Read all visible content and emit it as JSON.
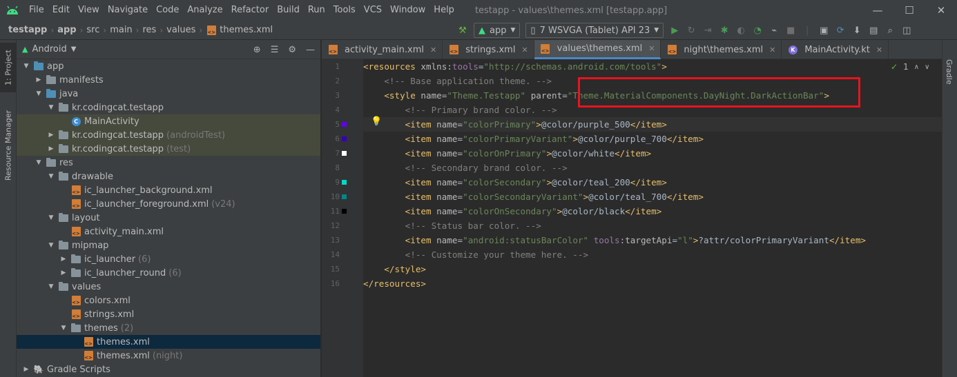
{
  "menu": {
    "items": [
      "File",
      "Edit",
      "View",
      "Navigate",
      "Code",
      "Analyze",
      "Refactor",
      "Build",
      "Run",
      "Tools",
      "VCS",
      "Window",
      "Help"
    ],
    "window_title": "testapp - values\\themes.xml [testapp.app]"
  },
  "breadcrumb": [
    "testapp",
    "app",
    "src",
    "main",
    "res",
    "values",
    "themes.xml"
  ],
  "run": {
    "config": "app",
    "device": "7  WSVGA (Tablet) API 23"
  },
  "left_tabs": {
    "project": "1: Project",
    "resource_manager": "Resource Manager"
  },
  "right_tabs": {
    "gradle": "Gradle"
  },
  "project": {
    "view": "Android",
    "tree": [
      {
        "label": "app",
        "suffix": "",
        "depth": 0,
        "expanded": true,
        "icon": "module-folder-icon"
      },
      {
        "label": "manifests",
        "suffix": "",
        "depth": 1,
        "expanded": false,
        "icon": "folder-icon"
      },
      {
        "label": "java",
        "suffix": "",
        "depth": 1,
        "expanded": true,
        "icon": "source-folder-icon"
      },
      {
        "label": "kr.codingcat.testapp",
        "suffix": "",
        "depth": 2,
        "expanded": true,
        "icon": "package-icon"
      },
      {
        "label": "MainActivity",
        "suffix": "",
        "depth": 3,
        "expanded": null,
        "icon": "kotlin-class-icon"
      },
      {
        "label": "kr.codingcat.testapp",
        "suffix": "(androidTest)",
        "depth": 2,
        "expanded": false,
        "icon": "package-icon"
      },
      {
        "label": "kr.codingcat.testapp",
        "suffix": "(test)",
        "depth": 2,
        "expanded": false,
        "icon": "package-icon"
      },
      {
        "label": "res",
        "suffix": "",
        "depth": 1,
        "expanded": true,
        "icon": "res-folder-icon"
      },
      {
        "label": "drawable",
        "suffix": "",
        "depth": 2,
        "expanded": true,
        "icon": "folder-icon"
      },
      {
        "label": "ic_launcher_background.xml",
        "suffix": "",
        "depth": 3,
        "expanded": null,
        "icon": "xml-file-icon"
      },
      {
        "label": "ic_launcher_foreground.xml",
        "suffix": "(v24)",
        "depth": 3,
        "expanded": null,
        "icon": "xml-file-icon"
      },
      {
        "label": "layout",
        "suffix": "",
        "depth": 2,
        "expanded": true,
        "icon": "folder-icon"
      },
      {
        "label": "activity_main.xml",
        "suffix": "",
        "depth": 3,
        "expanded": null,
        "icon": "xml-file-icon"
      },
      {
        "label": "mipmap",
        "suffix": "",
        "depth": 2,
        "expanded": true,
        "icon": "folder-icon"
      },
      {
        "label": "ic_launcher",
        "suffix": "(6)",
        "depth": 3,
        "expanded": false,
        "icon": "folder-icon"
      },
      {
        "label": "ic_launcher_round",
        "suffix": "(6)",
        "depth": 3,
        "expanded": false,
        "icon": "folder-icon"
      },
      {
        "label": "values",
        "suffix": "",
        "depth": 2,
        "expanded": true,
        "icon": "folder-icon"
      },
      {
        "label": "colors.xml",
        "suffix": "",
        "depth": 3,
        "expanded": null,
        "icon": "xml-file-icon"
      },
      {
        "label": "strings.xml",
        "suffix": "",
        "depth": 3,
        "expanded": null,
        "icon": "xml-file-icon"
      },
      {
        "label": "themes",
        "suffix": "(2)",
        "depth": 3,
        "expanded": true,
        "icon": "folder-icon"
      },
      {
        "label": "themes.xml",
        "suffix": "",
        "depth": 4,
        "expanded": null,
        "icon": "xml-file-icon"
      },
      {
        "label": "themes.xml",
        "suffix": "(night)",
        "depth": 4,
        "expanded": null,
        "icon": "xml-file-icon"
      },
      {
        "label": "Gradle Scripts",
        "suffix": "",
        "depth": 0,
        "expanded": false,
        "icon": "gradle-icon"
      }
    ]
  },
  "tabs": [
    {
      "label": "activity_main.xml",
      "active": false,
      "icon": "xml-file-icon"
    },
    {
      "label": "strings.xml",
      "active": false,
      "icon": "xml-file-icon"
    },
    {
      "label": "values\\themes.xml",
      "active": true,
      "icon": "xml-file-icon"
    },
    {
      "label": "night\\themes.xml",
      "active": false,
      "icon": "xml-file-icon"
    },
    {
      "label": "MainActivity.kt",
      "active": false,
      "icon": "kotlin-file-icon"
    }
  ],
  "inspection": {
    "count": "1"
  },
  "editor": {
    "lines": [
      {
        "n": "1",
        "swatch": null,
        "parts": [
          [
            "tag",
            "<resources "
          ],
          [
            "attr",
            "xmlns:"
          ],
          [
            "ns",
            "tools"
          ],
          [
            "plain",
            "="
          ],
          [
            "val",
            "\"http://schemas.android.com/tools\""
          ],
          [
            "tag",
            ">"
          ]
        ]
      },
      {
        "n": "2",
        "swatch": null,
        "parts": [
          [
            "plain",
            "    "
          ],
          [
            "cmt",
            "<!-- Base application theme. -->"
          ]
        ]
      },
      {
        "n": "3",
        "swatch": null,
        "parts": [
          [
            "plain",
            "    "
          ],
          [
            "tag",
            "<style "
          ],
          [
            "attr",
            "name"
          ],
          [
            "plain",
            "="
          ],
          [
            "val",
            "\"Theme.Testapp\""
          ],
          [
            "plain",
            " "
          ],
          [
            "attr",
            "parent"
          ],
          [
            "plain",
            "="
          ],
          [
            "val",
            "\"Theme.MaterialComponents.DayNight.DarkActionBar\""
          ],
          [
            "tag",
            ">"
          ]
        ]
      },
      {
        "n": "4",
        "swatch": null,
        "parts": [
          [
            "plain",
            "        "
          ],
          [
            "cmt",
            "<!-- Primary brand color. -->"
          ]
        ]
      },
      {
        "n": "5",
        "swatch": "#6200ee",
        "parts": [
          [
            "plain",
            "        "
          ],
          [
            "tag",
            "<item "
          ],
          [
            "attr",
            "name"
          ],
          [
            "plain",
            "="
          ],
          [
            "val",
            "\"colorPrimary\""
          ],
          [
            "tag",
            ">"
          ],
          [
            "plain",
            "@color/purple_500"
          ],
          [
            "tag",
            "</item>"
          ]
        ]
      },
      {
        "n": "6",
        "swatch": "#3700b3",
        "parts": [
          [
            "plain",
            "        "
          ],
          [
            "tag",
            "<item "
          ],
          [
            "attr",
            "name"
          ],
          [
            "plain",
            "="
          ],
          [
            "val",
            "\"colorPrimaryVariant\""
          ],
          [
            "tag",
            ">"
          ],
          [
            "plain",
            "@color/purple_700"
          ],
          [
            "tag",
            "</item>"
          ]
        ]
      },
      {
        "n": "7",
        "swatch": "#ffffff",
        "parts": [
          [
            "plain",
            "        "
          ],
          [
            "tag",
            "<item "
          ],
          [
            "attr",
            "name"
          ],
          [
            "plain",
            "="
          ],
          [
            "val",
            "\"colorOnPrimary\""
          ],
          [
            "tag",
            ">"
          ],
          [
            "plain",
            "@color/white"
          ],
          [
            "tag",
            "</item>"
          ]
        ]
      },
      {
        "n": "8",
        "swatch": null,
        "parts": [
          [
            "plain",
            "        "
          ],
          [
            "cmt",
            "<!-- Secondary brand color. -->"
          ]
        ]
      },
      {
        "n": "9",
        "swatch": "#03dac5",
        "parts": [
          [
            "plain",
            "        "
          ],
          [
            "tag",
            "<item "
          ],
          [
            "attr",
            "name"
          ],
          [
            "plain",
            "="
          ],
          [
            "val",
            "\"colorSecondary\""
          ],
          [
            "tag",
            ">"
          ],
          [
            "plain",
            "@color/teal_200"
          ],
          [
            "tag",
            "</item>"
          ]
        ]
      },
      {
        "n": "10",
        "swatch": "#018786",
        "parts": [
          [
            "plain",
            "        "
          ],
          [
            "tag",
            "<item "
          ],
          [
            "attr",
            "name"
          ],
          [
            "plain",
            "="
          ],
          [
            "val",
            "\"colorSecondaryVariant\""
          ],
          [
            "tag",
            ">"
          ],
          [
            "plain",
            "@color/teal_700"
          ],
          [
            "tag",
            "</item>"
          ]
        ]
      },
      {
        "n": "11",
        "swatch": "#000000",
        "parts": [
          [
            "plain",
            "        "
          ],
          [
            "tag",
            "<item "
          ],
          [
            "attr",
            "name"
          ],
          [
            "plain",
            "="
          ],
          [
            "val",
            "\"colorOnSecondary\""
          ],
          [
            "tag",
            ">"
          ],
          [
            "plain",
            "@color/black"
          ],
          [
            "tag",
            "</item>"
          ]
        ]
      },
      {
        "n": "12",
        "swatch": null,
        "parts": [
          [
            "plain",
            "        "
          ],
          [
            "cmt",
            "<!-- Status bar color. -->"
          ]
        ]
      },
      {
        "n": "13",
        "swatch": null,
        "parts": [
          [
            "plain",
            "        "
          ],
          [
            "tag",
            "<item "
          ],
          [
            "attr",
            "name"
          ],
          [
            "plain",
            "="
          ],
          [
            "val",
            "\"android:statusBarColor\""
          ],
          [
            "plain",
            " "
          ],
          [
            "ns",
            "tools"
          ],
          [
            "attr",
            ":targetApi"
          ],
          [
            "plain",
            "="
          ],
          [
            "val",
            "\"l\""
          ],
          [
            "tag",
            ">"
          ],
          [
            "plain",
            "?attr/colorPrimaryVariant"
          ],
          [
            "tag",
            "</item>"
          ]
        ]
      },
      {
        "n": "14",
        "swatch": null,
        "parts": [
          [
            "plain",
            "        "
          ],
          [
            "cmt",
            "<!-- Customize your theme here. -->"
          ]
        ]
      },
      {
        "n": "15",
        "swatch": null,
        "parts": [
          [
            "plain",
            "    "
          ],
          [
            "tag",
            "</style>"
          ]
        ]
      },
      {
        "n": "16",
        "swatch": null,
        "parts": [
          [
            "tag",
            "</resources>"
          ]
        ]
      }
    ]
  }
}
